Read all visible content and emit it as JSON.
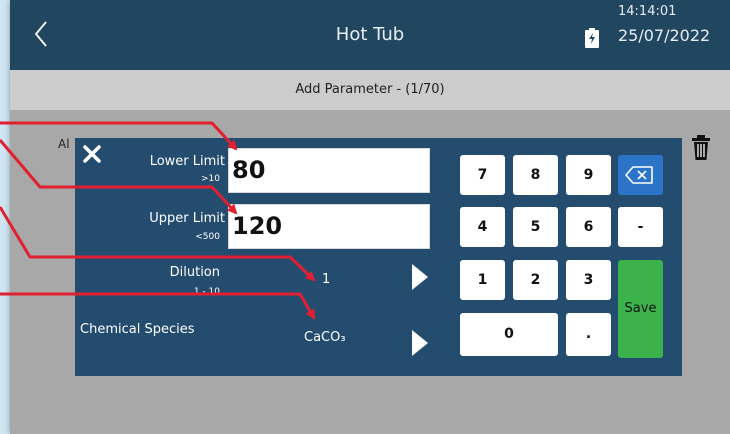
{
  "header": {
    "title": "Hot Tub",
    "time": "14:14:01",
    "date": "25/07/2022",
    "back_icon": "chevron-left-icon",
    "battery_icon": "battery-charging-icon"
  },
  "subheader": {
    "text": "Add Parameter - (1/70)"
  },
  "background": {
    "partial_label": "Al",
    "trash_icon": "trash-icon"
  },
  "dialog": {
    "close_icon": "close-icon",
    "lower_limit": {
      "label": "Lower Limit",
      "hint": ">10",
      "value": "80"
    },
    "upper_limit": {
      "label": "Upper Limit",
      "hint": "<500",
      "value": "120"
    },
    "dilution": {
      "label": "Dilution",
      "hint": "1 - 10",
      "value": "1"
    },
    "chemical_species": {
      "label": "Chemical Species",
      "value": "CaCO₃"
    },
    "keypad": {
      "keys": [
        "7",
        "8",
        "9",
        "4",
        "5",
        "6",
        "1",
        "2",
        "3",
        "0",
        ".",
        "-"
      ],
      "backspace_icon": "backspace-icon",
      "save_label": "Save"
    }
  },
  "colors": {
    "header_bg": "#214660",
    "dialog_bg": "#244c6e",
    "backspace_bg": "#2b74c7",
    "save_bg": "#3cb24a",
    "annotation_red": "#e02030"
  }
}
